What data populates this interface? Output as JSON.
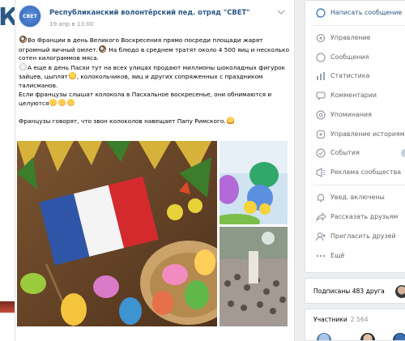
{
  "background_page": {
    "cut_letter": "К"
  },
  "post": {
    "author": "Республиканский волонтёрский пед. отряд \"СВЕТ\"",
    "avatar_text": "СВЕТ",
    "date": "19 апр в 13:00",
    "menu_icon": "chevron-down-icon",
    "text": {
      "p1a": "Во Франции в день Великого Воскресения прямо посреди площади жарят огромный яичный омлет.",
      "p1b": "На блюдо в среднем тратят около 4 500 яиц и несколько сотен килограммов мяса.",
      "p2a": "А еще в день Пасхи тут на всех улицах продают миллионы шоколадных фигурок зайцев, цыплят",
      "p2b": ", колокольчиков, яиц и других сопряженных с праздником талисманов.",
      "p3": "Если французы слышат колокола в Пасхальное воскресенье, они обнимаются и целуются",
      "p4": "Французы говорят, что звон колоколов навещает Папу Римского."
    },
    "photos": [
      "easter-eggs-french-flag-photo",
      "easter-decoration-photo",
      "square-crowd-photo"
    ]
  },
  "sidebar": {
    "menu": [
      {
        "label": "Написать сообщение",
        "icon": "message-icon",
        "style": "primary"
      },
      {
        "label": "Управление",
        "icon": "gear-icon",
        "style": "muted"
      },
      {
        "label": "Сообщения",
        "icon": "chat-icon",
        "style": "muted"
      },
      {
        "label": "Статистика",
        "icon": "stats-icon",
        "style": "muted"
      },
      {
        "label": "Комментарии",
        "icon": "comment-icon",
        "style": "muted"
      },
      {
        "label": "Упоминания",
        "icon": "mention-icon",
        "style": "muted"
      },
      {
        "label": "Управление историями",
        "icon": "stories-icon",
        "style": "muted"
      },
      {
        "label": "События",
        "icon": "events-icon",
        "style": "muted"
      },
      {
        "label": "Реклама сообщества",
        "icon": "ads-icon",
        "style": "muted"
      },
      {
        "label": "Увед. включены",
        "icon": "bell-icon",
        "style": "muted"
      },
      {
        "label": "Рассказать друзьям",
        "icon": "share-icon",
        "style": "muted"
      },
      {
        "label": "Пригласить друзей",
        "icon": "invite-icon",
        "style": "muted"
      },
      {
        "label": "Ещё",
        "icon": "more-icon",
        "style": "muted"
      }
    ],
    "friends": {
      "label": "Подписаны 483 друга"
    },
    "members": {
      "label": "Участники",
      "count": "2 564"
    }
  },
  "colors": {
    "link": "#2a5885",
    "muted": "#656565",
    "background": "#edeef0",
    "card": "#ffffff"
  }
}
